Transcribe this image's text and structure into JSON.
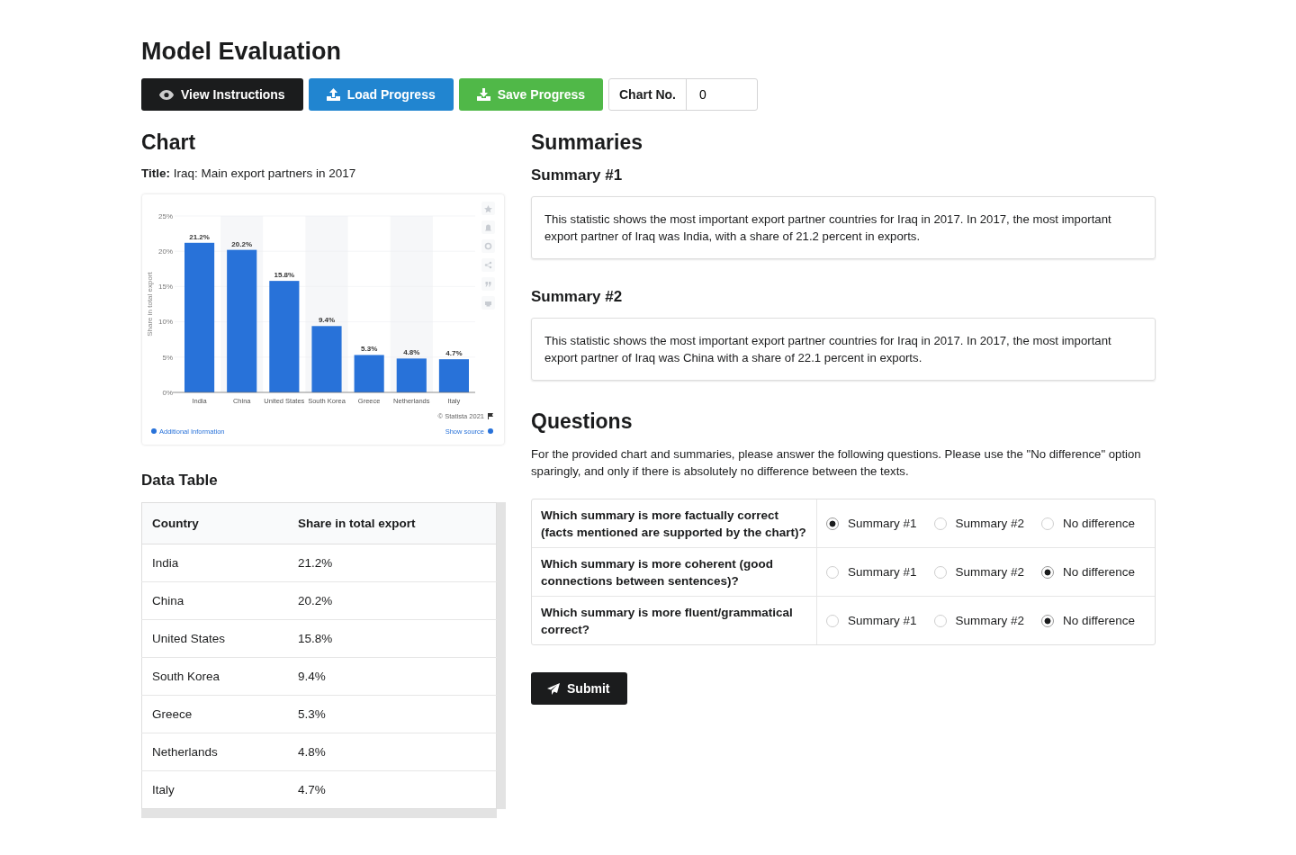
{
  "page_title": "Model Evaluation",
  "toolbar": {
    "buttons": [
      {
        "label": "View Instructions",
        "kind": "instructions"
      },
      {
        "label": "Load Progress",
        "kind": "load"
      },
      {
        "label": "Save Progress",
        "kind": "save"
      }
    ],
    "chart_number": {
      "label": "Chart No.",
      "value": "0"
    }
  },
  "chart_section": {
    "heading": "Chart",
    "title": "**Title:** Iraq: Main export partners in 2017",
    "chart_data": {
      "type": "bar",
      "ylabel": "Share in total export",
      "categories": [
        "India",
        "China",
        "United States",
        "South Korea",
        "Greece",
        "Netherlands",
        "Italy"
      ],
      "grid": true,
      "series": [
        {
          "color": "#2872d9",
          "values": [
            21.2,
            20.2,
            15.8,
            9.4,
            5.3,
            4.8,
            4.7
          ]
        }
      ],
      "ylim": [
        0,
        25
      ],
      "yticks": [
        {
          "value": 0,
          "label": "0%"
        },
        {
          "value": 5,
          "label": "5%"
        },
        {
          "value": 10,
          "label": "10%"
        },
        {
          "value": 15,
          "label": "15%"
        },
        {
          "value": 20,
          "label": "20%"
        },
        {
          "value": 25,
          "label": "25%"
        }
      ],
      "value_labels": [
        "21.2%",
        "20.2%",
        "15.8%",
        "9.4%",
        "5.3%",
        "4.8%",
        "4.7%"
      ]
    },
    "credit": "© Statista 2021",
    "info_link": "Additional Information",
    "source_link": "Show source"
  },
  "data_table": {
    "heading": "Data Table",
    "columns": [
      "Country",
      "Share in total export"
    ],
    "rows": [
      [
        "India",
        "21.2%"
      ],
      [
        "China",
        "20.2%"
      ],
      [
        "United States",
        "15.8%"
      ],
      [
        "South Korea",
        "9.4%"
      ],
      [
        "Greece",
        "5.3%"
      ],
      [
        "Netherlands",
        "4.8%"
      ],
      [
        "Italy",
        "4.7%"
      ]
    ]
  },
  "summaries": {
    "heading": "Summaries",
    "items": [
      {
        "title": "Summary #1",
        "text": "This statistic shows the most important export partner countries for Iraq in 2017. In 2017, the most important export partner of Iraq was India, with a share of 21.2 percent in exports."
      },
      {
        "title": "Summary #2",
        "text": "This statistic shows the most important export partner countries for Iraq in 2017. In 2017, the most important export partner of Iraq was China with a share of 22.1 percent in exports."
      }
    ]
  },
  "questions": {
    "heading": "Questions",
    "intro": "For the provided chart and summaries, please answer the following questions. Please use the \"No difference\" option sparingly, and only if there is absolutely no difference between the texts.",
    "items": [
      {
        "question": "Which summary is more factually correct (facts mentioned are supported by the chart)?",
        "options": [
          {
            "label": "Summary #1",
            "selected": true
          },
          {
            "label": "Summary #2",
            "selected": false
          },
          {
            "label": "No difference",
            "selected": false
          }
        ]
      },
      {
        "question": "Which summary is more coherent (good connections between sentences)?",
        "options": [
          {
            "label": "Summary #1",
            "selected": false
          },
          {
            "label": "Summary #2",
            "selected": false
          },
          {
            "label": "No difference",
            "selected": true
          }
        ]
      },
      {
        "question": "Which summary is more fluent/grammatical correct?",
        "options": [
          {
            "label": "Summary #1",
            "selected": false
          },
          {
            "label": "Summary #2",
            "selected": false
          },
          {
            "label": "No difference",
            "selected": true
          }
        ]
      }
    ]
  },
  "submit": {
    "label": "Submit"
  }
}
